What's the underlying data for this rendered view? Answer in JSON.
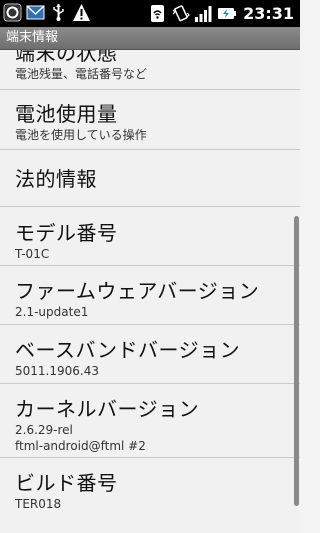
{
  "status_bar": {
    "time": "23:31",
    "icons_left": [
      "sync-icon",
      "email-icon",
      "usb-icon",
      "warning-icon"
    ],
    "icons_right": [
      "wifi-icon",
      "vibrate-icon",
      "signal-icon",
      "battery-charging-icon"
    ]
  },
  "title_bar": {
    "title": "端末情報"
  },
  "items": [
    {
      "title": "端末の状態",
      "subtitle": "電池残量、電話番号など"
    },
    {
      "title": "電池使用量",
      "subtitle": "電池を使用している操作"
    },
    {
      "title": "法的情報",
      "subtitle": ""
    },
    {
      "title": "モデル番号",
      "subtitle": "T-01C"
    },
    {
      "title": "ファームウェアバージョン",
      "subtitle": "2.1-update1"
    },
    {
      "title": "ベースバンドバージョン",
      "subtitle": "5011.1906.43"
    },
    {
      "title": "カーネルバージョン",
      "subtitle": "2.6.29-rel",
      "subtitle2": "ftml-android@ftml #2"
    },
    {
      "title": "ビルド番号",
      "subtitle": "TER018"
    }
  ]
}
